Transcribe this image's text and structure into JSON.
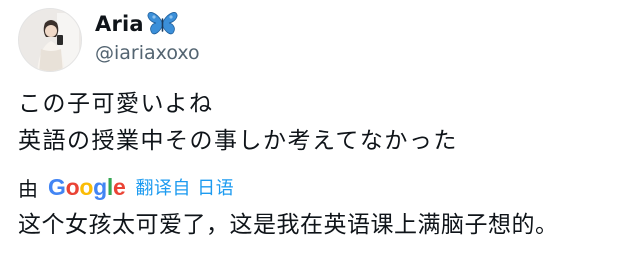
{
  "author": {
    "display_name": "Aria",
    "handle": "@iariaxoxo",
    "name_emoji_icon": "butterfly-icon",
    "avatar_icon": "profile-photo"
  },
  "tweet": {
    "lines": [
      "この子可愛いよね",
      "英語の授業中その事しか考えてなかった"
    ]
  },
  "translation": {
    "by_label": "由",
    "provider_logo": {
      "letters": [
        "G",
        "o",
        "o",
        "g",
        "l",
        "e"
      ],
      "colors": [
        "#4285f4",
        "#ea4335",
        "#fbbc05",
        "#4285f4",
        "#34a853",
        "#ea4335"
      ]
    },
    "from_label": "翻译自 日语",
    "text": "这个女孩太可爱了，这是我在英语课上满脑子想的。"
  },
  "colors": {
    "text_primary": "#0f1419",
    "text_secondary": "#536471",
    "link": "#1d9bf0",
    "butterfly": "#3b8fd9",
    "background": "#ffffff"
  }
}
